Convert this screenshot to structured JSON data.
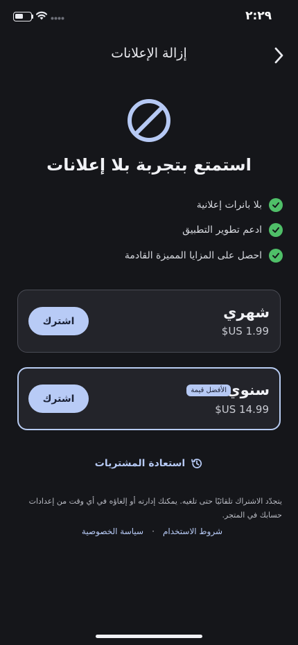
{
  "status_bar": {
    "time": "٢:٢٩",
    "icons": [
      "battery-icon",
      "wifi-icon",
      "signal-icon"
    ]
  },
  "header": {
    "title": "إزالة الإعلانات",
    "back_icon": "chevron-right-icon"
  },
  "hero": {
    "icon": "no-ads-icon",
    "title": "استمتع بتجربة بلا إعلانات"
  },
  "features": [
    {
      "label": "بلا بانرات إعلانية"
    },
    {
      "label": "ادعم تطوير التطبيق"
    },
    {
      "label": "احصل على المزايا المميزة القادمة"
    }
  ],
  "plans": {
    "monthly": {
      "name": "شهري",
      "price": "$US 1.99",
      "button": "اشترك"
    },
    "yearly": {
      "name": "سنوي",
      "badge": "الأفضل قيمة",
      "price": "$US 14.99",
      "button": "اشترك"
    }
  },
  "restore": {
    "label": "استعادة المشتريات",
    "icon": "history-icon"
  },
  "footer": {
    "text": "يتجدّد الاشتراك تلقائيًا حتى تلغيه. يمكنك إدارته أو إلغاؤه في أي وقت من إعدادات حسابك في المتجر.",
    "terms_link": "شروط الاستخدام",
    "separator": "·",
    "privacy_link": "سياسة الخصوصية"
  },
  "colors": {
    "background": "#15161a",
    "accent": "#b6c9f4",
    "check": "#4fbf68",
    "card": "#23242a"
  }
}
